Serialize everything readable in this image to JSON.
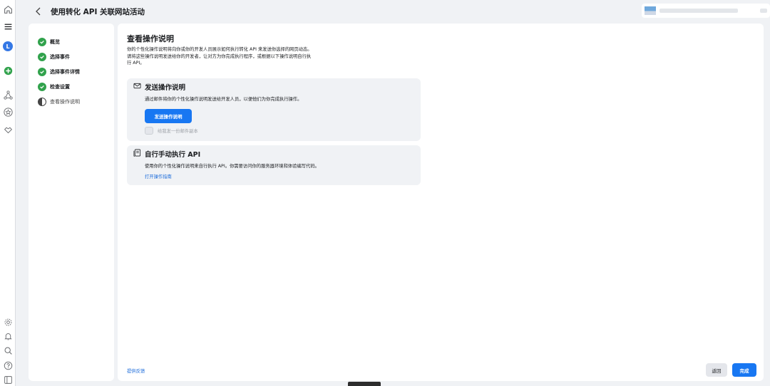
{
  "header": {
    "title": "使用转化 API 关联网站活动"
  },
  "rail": {
    "avatar_letter": "L"
  },
  "steps": [
    {
      "label": "概览",
      "state": "done"
    },
    {
      "label": "选择事件",
      "state": "done"
    },
    {
      "label": "选择事件详情",
      "state": "done"
    },
    {
      "label": "检查设置",
      "state": "done"
    },
    {
      "label": "查看操作说明",
      "state": "current"
    }
  ],
  "main": {
    "heading": "查看操作说明",
    "description_lines": [
      "你的个性化操作说明将向你或你的开发人员展示如何执行转化 API 来发送你选择的网页动态。",
      "请将这些操作说明发送给你的开发者，让对方为你完成执行程序，或根据以下操作说明自行执",
      "行 API。"
    ],
    "send_card": {
      "title": "发送操作说明",
      "text": "通过邮件将你的个性化操作说明发送给开发人员，以便他们为你完成执行操作。",
      "button": "发送操作说明",
      "checkbox_label": "给我发一份邮件副本"
    },
    "manual_card": {
      "title": "自行手动执行 API",
      "text": "使用你的个性化操作说明来自行执行 API。你需要访问你的服务器环境和体验编写代码。",
      "link": "打开操作指南"
    },
    "feedback_link": "提供反馈",
    "back_button": "返回",
    "done_button": "完成"
  },
  "colors": {
    "accent": "#1877f2",
    "success": "#31a24c",
    "link": "#216fdb"
  }
}
